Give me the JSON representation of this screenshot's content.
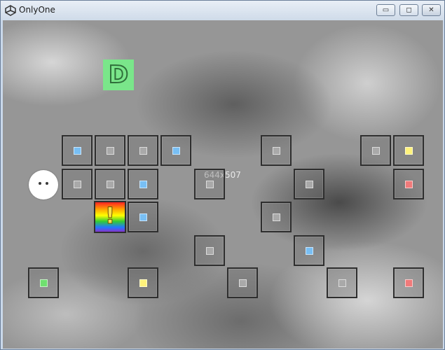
{
  "window": {
    "title": "OnlyOne",
    "icon": "unity-logo-icon",
    "buttons": {
      "minimize": "minimize-icon",
      "maximize": "maximize-icon",
      "close": "close-icon"
    }
  },
  "game": {
    "d_block": {
      "label": "D",
      "color": "#7ae68a"
    },
    "special_block": {
      "label": "!"
    },
    "size_label": "644x507",
    "colors": {
      "blue": "#78bff4",
      "gray": "#a9a9a9",
      "yellow": "#fff27a",
      "red": "#f07a7a",
      "green": "#6fe06f"
    },
    "tile_colors": [
      "blue",
      "gray",
      "gray",
      "blue",
      "gray",
      "gray",
      "yellow",
      "gray",
      "gray",
      "blue",
      "gray",
      "gray",
      "red",
      "blue",
      "gray",
      "gray",
      "blue",
      "green",
      "yellow",
      "gray",
      "gray",
      "red"
    ]
  }
}
